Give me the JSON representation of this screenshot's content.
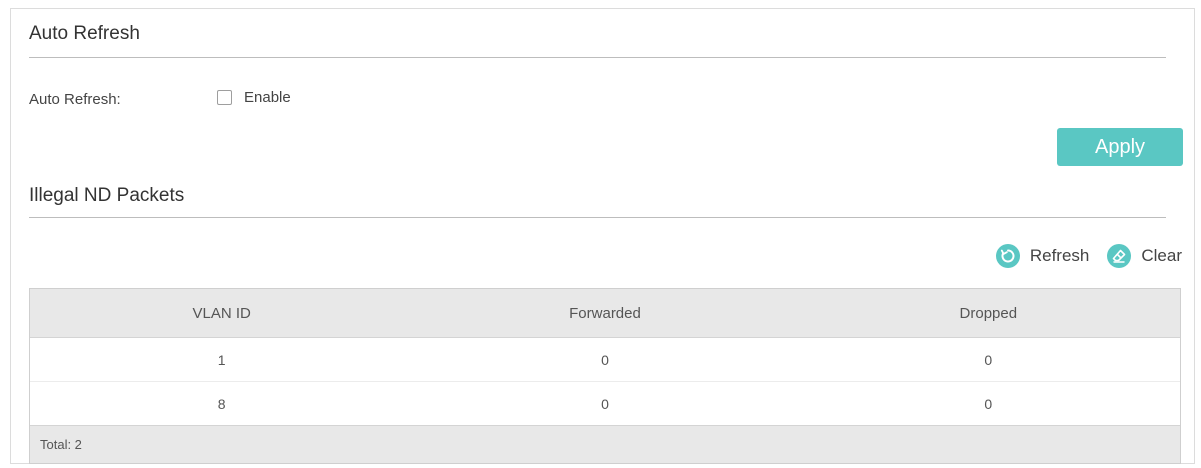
{
  "auto_refresh": {
    "title": "Auto Refresh",
    "field_label": "Auto Refresh:",
    "checkbox_label": "Enable",
    "checked": false,
    "apply_label": "Apply"
  },
  "illegal_nd": {
    "title": "Illegal ND Packets",
    "refresh_label": "Refresh",
    "clear_label": "Clear",
    "refresh_icon": "refresh-icon",
    "clear_icon": "eraser-icon"
  },
  "table": {
    "headers": [
      "VLAN ID",
      "Forwarded",
      "Dropped"
    ],
    "rows": [
      [
        "1",
        "0",
        "0"
      ],
      [
        "8",
        "0",
        "0"
      ]
    ],
    "footer": "Total: 2"
  },
  "colors": {
    "accent": "#5ac7c3"
  }
}
